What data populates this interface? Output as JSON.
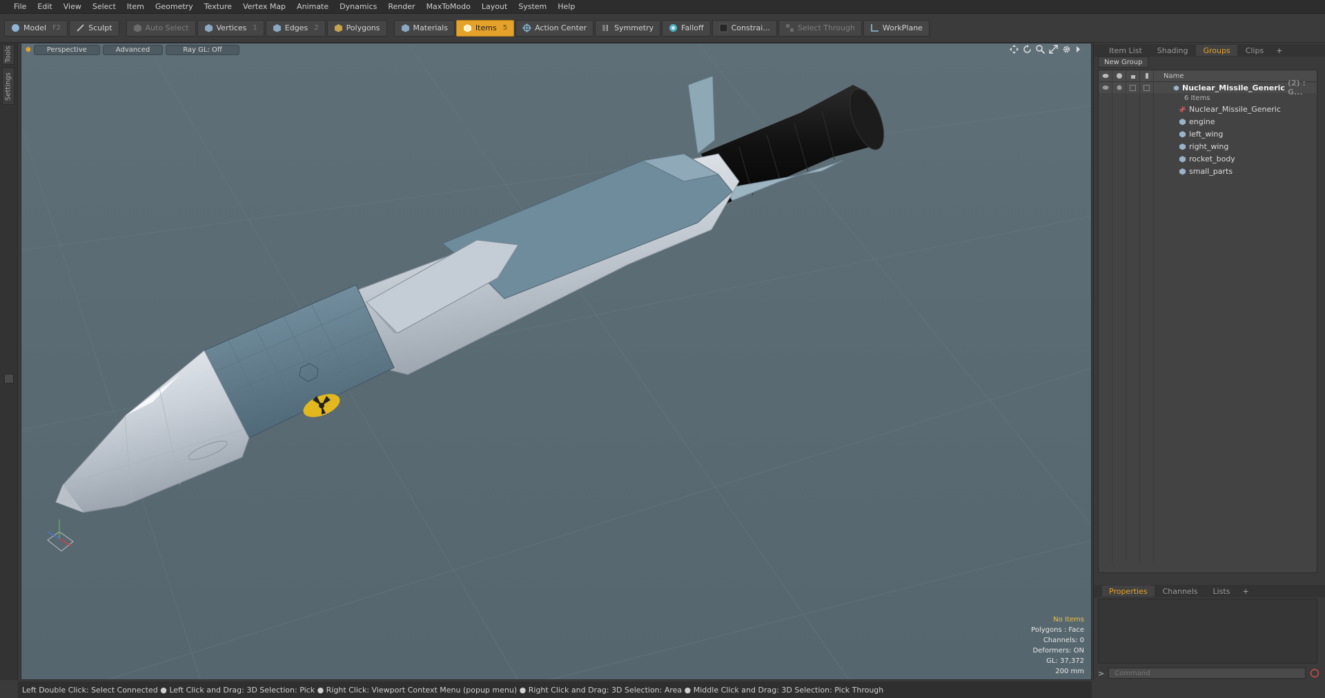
{
  "menu": [
    "File",
    "Edit",
    "View",
    "Select",
    "Item",
    "Geometry",
    "Texture",
    "Vertex Map",
    "Animate",
    "Dynamics",
    "Render",
    "MaxToModo",
    "Layout",
    "System",
    "Help"
  ],
  "toolbar": {
    "model": "Model",
    "model_key": "F2",
    "sculpt": "Sculpt",
    "auto_select": "Auto Select",
    "vertices": "Vertices",
    "vertices_key": "1",
    "edges": "Edges",
    "edges_key": "2",
    "polygons": "Polygons",
    "materials": "Materials",
    "items": "Items",
    "items_key": "5",
    "action_center": "Action Center",
    "symmetry": "Symmetry",
    "falloff": "Falloff",
    "constraints": "Constrai...",
    "select_through": "Select Through",
    "workplane": "WorkPlane"
  },
  "left_tabs": [
    "Tools",
    "Settings"
  ],
  "viewport": {
    "view_mode": "Perspective",
    "shading": "Advanced",
    "raygl": "Ray GL: Off",
    "info": {
      "selection": "No Items",
      "polygons": "Polygons : Face",
      "channels": "Channels: 0",
      "deformers": "Deformers: ON",
      "gl": "GL: 37,372",
      "scale": "200 mm"
    }
  },
  "right_panel": {
    "tabs": [
      "Item List",
      "Shading",
      "Groups",
      "Clips"
    ],
    "active_tab": "Groups",
    "new_group": "New Group",
    "name_header": "Name",
    "group": {
      "name": "Nuclear_Missile_Generic",
      "suffix": "(2) : G...",
      "count": "6 Items"
    },
    "items": [
      "Nuclear_Missile_Generic",
      "engine",
      "left_wing",
      "right_wing",
      "rocket_body",
      "small_parts"
    ],
    "bottom_tabs": [
      "Properties",
      "Channels",
      "Lists"
    ],
    "bottom_active": "Properties",
    "command_placeholder": "Command",
    "command_prompt": ">"
  },
  "status": "Left Double Click: Select Connected ● Left Click and Drag: 3D Selection: Pick ● Right Click: Viewport Context Menu (popup menu) ● Right Click and Drag: 3D Selection: Area ● Middle Click and Drag: 3D Selection: Pick Through",
  "colors": {
    "accent": "#e5a22a",
    "viewport_bg": "#5a6a72",
    "panel_bg": "#3a3a3a"
  }
}
